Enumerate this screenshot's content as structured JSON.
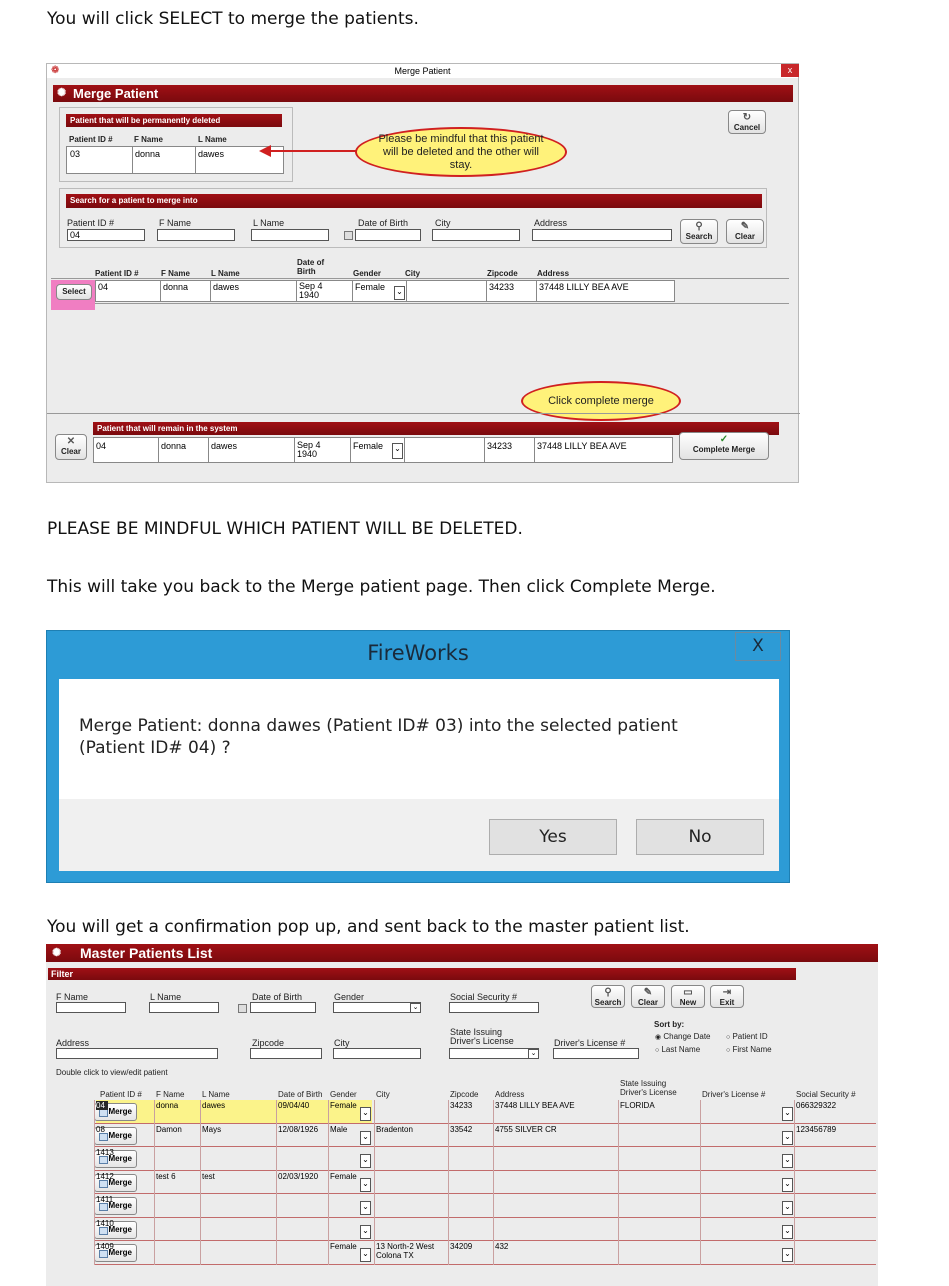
{
  "doc": {
    "line1": "You will click SELECT to merge the patients.",
    "line2": "PLEASE BE MINDFUL WHICH PATIENT WILL BE DELETED.",
    "line3": "This will take you back to the Merge patient page. Then click Complete Merge.",
    "line4": "You will get a confirmation pop up, and sent back to the master patient list."
  },
  "merge_window": {
    "title": "Merge Patient",
    "header": "Merge Patient",
    "close": "x",
    "deleted_section": {
      "title": "Patient that will be permanently deleted",
      "col_id": "Patient ID #",
      "col_fname": "F Name",
      "col_lname": "L Name",
      "id": "03",
      "fname": "donna",
      "lname": "dawes"
    },
    "callout1": "Please be mindful that this patient will be deleted and the other will stay.",
    "cancel": "Cancel",
    "search_section": {
      "title": "Search for a patient to merge into",
      "lbl_id": "Patient ID #",
      "lbl_fname": "F Name",
      "lbl_lname": "L Name",
      "lbl_dob": "Date of Birth",
      "lbl_city": "City",
      "lbl_address": "Address",
      "id_value": "04",
      "search": "Search",
      "clear": "Clear"
    },
    "results": {
      "col_id": "Patient ID #",
      "col_fname": "F Name",
      "col_lname": "L Name",
      "col_dob": "Date of Birth",
      "col_gender": "Gender",
      "col_city": "City",
      "col_zip": "Zipcode",
      "col_address": "Address",
      "select": "Select",
      "id": "04",
      "fname": "donna",
      "lname": "dawes",
      "dob": "Sep  4 1940",
      "gender": "Female",
      "zip": "34233",
      "address": "37448  LILLY BEA AVE"
    },
    "callout2": "Click complete merge",
    "remain_section": {
      "title": "Patient that will remain in the system",
      "clear": "Clear",
      "id": "04",
      "fname": "donna",
      "lname": "dawes",
      "dob": "Sep  4 1940",
      "gender": "Female",
      "zip": "34233",
      "address": "37448  LILLY BEA AVE",
      "complete": "Complete Merge"
    }
  },
  "dialog": {
    "title": "FireWorks",
    "close": "X",
    "message": "Merge Patient: donna dawes (Patient ID# 03) into the selected patient (Patient ID# 04) ?",
    "yes": "Yes",
    "no": "No"
  },
  "master": {
    "header": "Master Patients List",
    "filter": "Filter",
    "lbl_fname": "F Name",
    "lbl_lname": "L Name",
    "lbl_dob": "Date of Birth",
    "lbl_gender": "Gender",
    "lbl_ssn": "Social Security #",
    "lbl_address": "Address",
    "lbl_zip": "Zipcode",
    "lbl_city": "City",
    "lbl_state": "State Issuing Driver's License",
    "lbl_dl": "Driver's License #",
    "btn_search": "Search",
    "btn_clear": "Clear",
    "btn_new": "New",
    "btn_exit": "Exit",
    "sort_by": "Sort by:",
    "sort_options": [
      "Change Date",
      "Patient ID",
      "Last Name",
      "First Name"
    ],
    "double_click": "Double click to view/edit patient",
    "columns": [
      "Patient ID #",
      "F Name",
      "L Name",
      "Date of Birth",
      "Gender",
      "City",
      "Zipcode",
      "Address",
      "State Issuing Driver's License",
      "Driver's License #",
      "Social Security #"
    ],
    "merge_label": "Merge",
    "rows": [
      {
        "id": "04",
        "fname": "donna",
        "lname": "dawes",
        "dob": "09/04/40",
        "gender": "Female",
        "city": "",
        "zip": "34233",
        "address": "37448  LILLY BEA AVE",
        "state": "FLORIDA",
        "dl": "",
        "ssn": "066329322"
      },
      {
        "id": "08",
        "fname": "Damon",
        "lname": "Mays",
        "dob": "12/08/1926",
        "gender": "Male",
        "city": "Bradenton",
        "zip": "33542",
        "address": "4755 SILVER CR",
        "state": "",
        "dl": "",
        "ssn": "123456789"
      },
      {
        "id": "1413",
        "fname": "",
        "lname": "",
        "dob": "",
        "gender": "",
        "city": "",
        "zip": "",
        "address": "",
        "state": "",
        "dl": "",
        "ssn": ""
      },
      {
        "id": "1412",
        "fname": "test 6",
        "lname": "test",
        "dob": "02/03/1920",
        "gender": "Female",
        "city": "",
        "zip": "",
        "address": "",
        "state": "",
        "dl": "",
        "ssn": ""
      },
      {
        "id": "1411",
        "fname": "",
        "lname": "",
        "dob": "",
        "gender": "",
        "city": "",
        "zip": "",
        "address": "",
        "state": "",
        "dl": "",
        "ssn": ""
      },
      {
        "id": "1410",
        "fname": "",
        "lname": "",
        "dob": "",
        "gender": "",
        "city": "",
        "zip": "",
        "address": "",
        "state": "",
        "dl": "",
        "ssn": ""
      },
      {
        "id": "1409",
        "fname": "",
        "lname": "",
        "dob": "",
        "gender": "Female",
        "city": "13 North-2 West Colona TX",
        "zip": "34209",
        "address": "432",
        "state": "",
        "dl": "",
        "ssn": ""
      }
    ]
  }
}
